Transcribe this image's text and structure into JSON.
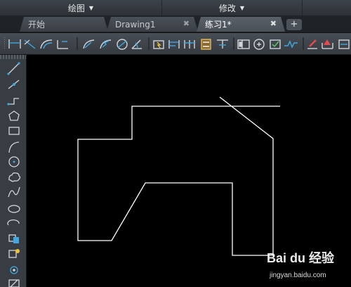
{
  "menubar": {
    "draw_label": "绘图",
    "modify_label": "修改"
  },
  "tabs": [
    {
      "label": "开始"
    },
    {
      "label": "Drawing1",
      "closable": true
    },
    {
      "label": "练习1*",
      "closable": true,
      "active": true
    }
  ],
  "tab_add_label": "+",
  "tab_close_glyph": "✖",
  "toolbar_icons": [
    "linear-dimension-icon",
    "aligned-dimension-icon",
    "arc-length-dimension-icon",
    "ordinate-dimension-icon",
    "radius-dimension-icon",
    "jogged-dimension-icon",
    "diameter-dimension-icon",
    "angular-dimension-icon",
    "quick-dimension-icon",
    "baseline-dimension-icon",
    "continue-dimension-icon",
    "dimension-space-icon",
    "dimension-break-icon",
    "tolerance-icon",
    "center-mark-icon",
    "inspection-icon",
    "jogged-linear-icon",
    "dimension-edit-icon",
    "dimension-text-edit-icon",
    "dimension-update-icon"
  ],
  "left_tools": [
    "line-icon",
    "construction-line-icon",
    "polyline-icon",
    "polygon-icon",
    "rectangle-icon",
    "arc-icon",
    "circle-icon",
    "revision-cloud-icon",
    "spline-icon",
    "ellipse-icon",
    "ellipse-arc-icon",
    "insert-block-icon",
    "make-block-icon",
    "point-icon",
    "hatch-icon"
  ],
  "watermark": {
    "brand": "Bai du 经验",
    "url": "jingyan.baidu.com"
  },
  "colors": {
    "canvas_bg": "#000000",
    "geometry_stroke": "#ffffff",
    "toolbar_bg": "#3f454b",
    "icon_accent": "#3fa7e1"
  }
}
